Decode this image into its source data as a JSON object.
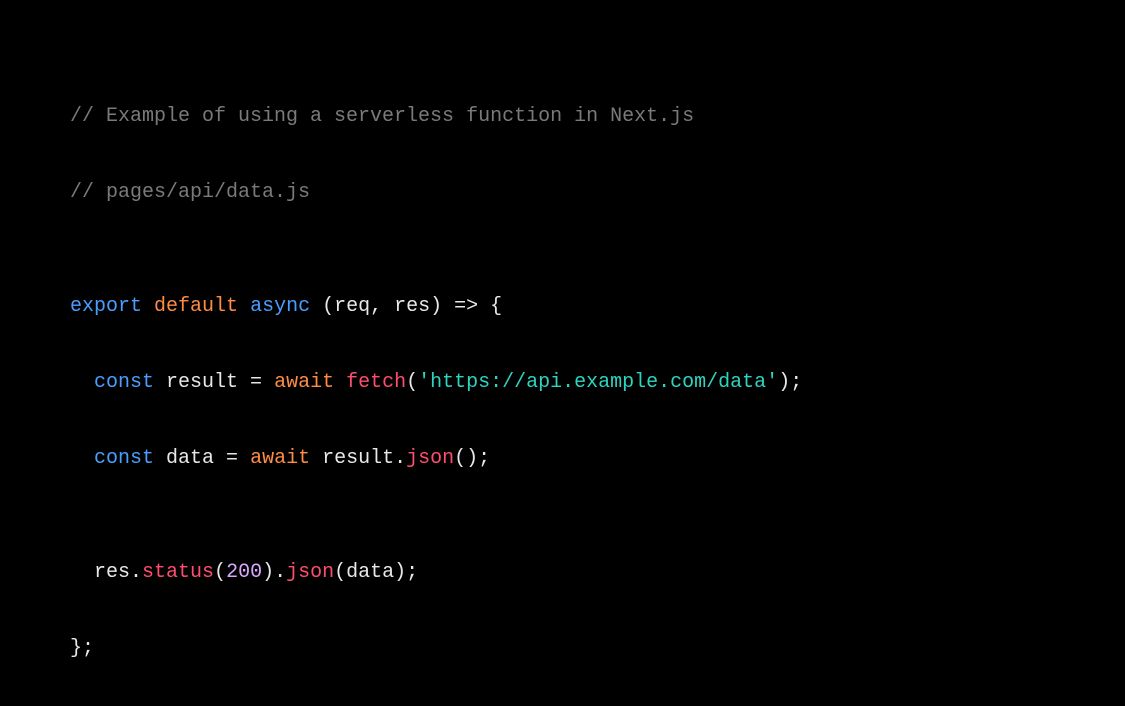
{
  "code": {
    "comment1": "// Example of using a serverless function in Next.js",
    "comment2": "// pages/api/data.js",
    "line4": {
      "export": "export",
      "default": "default",
      "async": "async",
      "params_open": " (",
      "param_req": "req",
      "comma": ", ",
      "param_res": "res",
      "params_close": ") ",
      "arrow": "=>",
      "brace_open": " {"
    },
    "line5": {
      "indent": "  ",
      "const": "const",
      "result": " result ",
      "equals": "= ",
      "await": "await",
      "space": " ",
      "fetch": "fetch",
      "paren_open": "(",
      "url": "'https://api.example.com/data'",
      "paren_close": ");"
    },
    "line6": {
      "indent": "  ",
      "const": "const",
      "data": " data ",
      "equals": "= ",
      "await": "await",
      "result": " result.",
      "json": "json",
      "call": "();"
    },
    "line8": {
      "indent": "  ",
      "res": "res.",
      "status": "status",
      "paren_open": "(",
      "code": "200",
      "paren_mid": ").",
      "json": "json",
      "paren_open2": "(",
      "data": "data",
      "paren_close": ");"
    },
    "line9": {
      "brace_close": "};"
    }
  }
}
